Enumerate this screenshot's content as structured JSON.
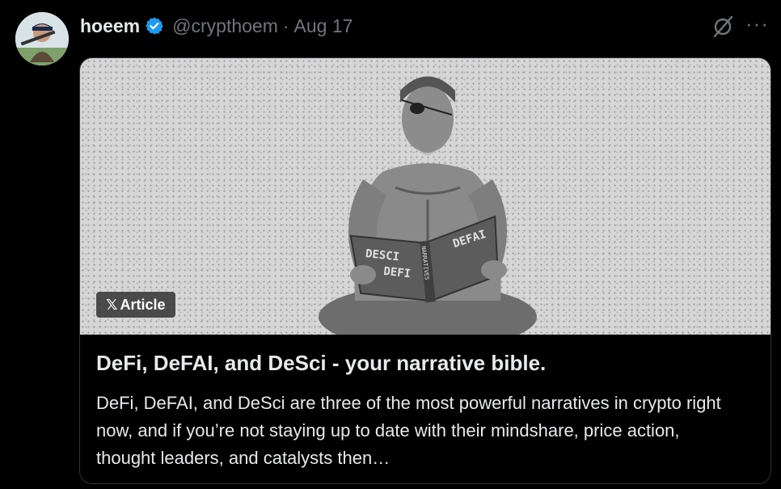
{
  "post": {
    "display_name": "hoeem",
    "handle": "@crypthoem",
    "separator": "·",
    "date": "Aug 17",
    "more_label": "···"
  },
  "article": {
    "badge_label": "Article",
    "badge_x": "𝕏",
    "title": "DeFi, DeFAI, and DeSci - your narrative bible.",
    "description": "DeFi, DeFAI, and DeSci are three of the most powerful narratives in crypto right now, and if you’re not staying up to date with their mindshare, price action, thought leaders, and catalysts then…",
    "book_left_top": "DESCI",
    "book_left_bottom": "DEFI",
    "book_spine": "NARRATIVES",
    "book_right": "DEFAI"
  },
  "colors": {
    "background": "#000000",
    "text_primary": "#e7e9ea",
    "text_secondary": "#71767b",
    "verified_blue": "#1d9bf0",
    "card_border": "#2f3336"
  },
  "icons": [
    "verified-badge-icon",
    "grok-icon",
    "more-options-icon",
    "x-logo-icon"
  ]
}
